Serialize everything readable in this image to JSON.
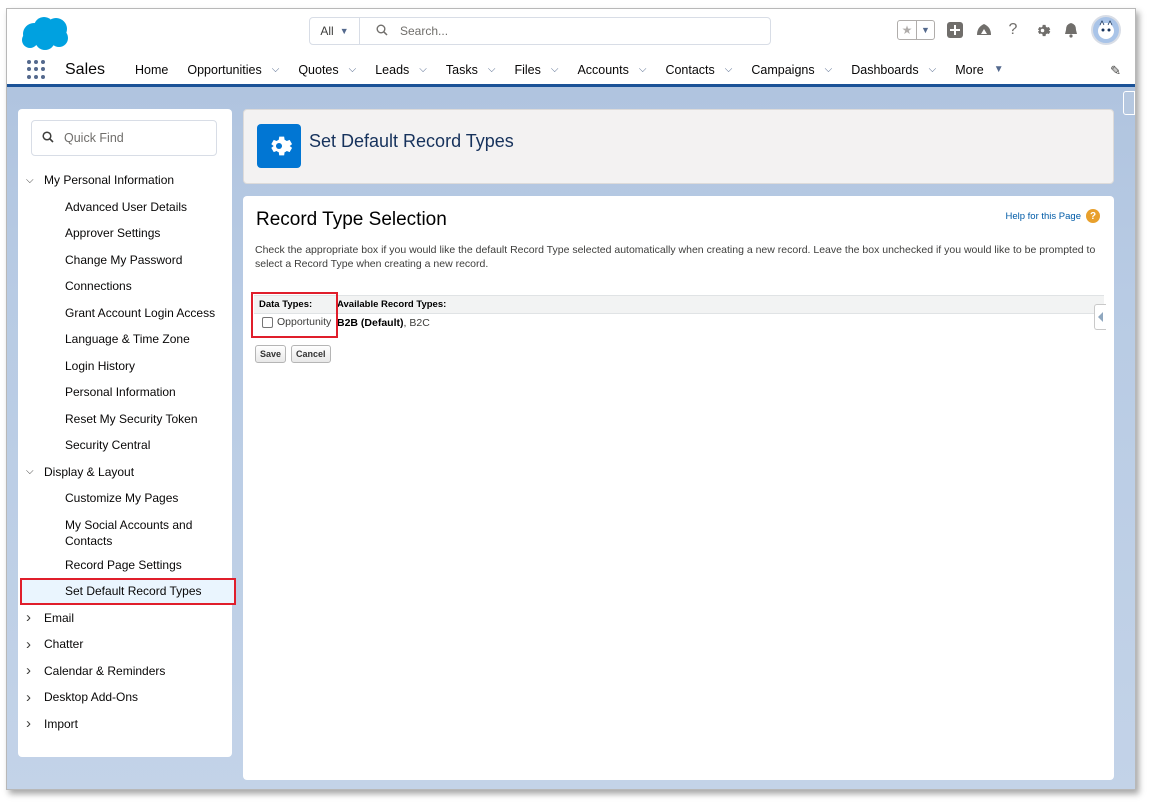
{
  "colors": {
    "brand": "#00a1e0",
    "accent": "#0176d3",
    "highlight": "#e01e2b"
  },
  "search": {
    "scope": "All",
    "placeholder": "Search..."
  },
  "nav": {
    "app_name": "Sales",
    "items": [
      {
        "label": "Home",
        "has_menu": false
      },
      {
        "label": "Opportunities",
        "has_menu": true
      },
      {
        "label": "Quotes",
        "has_menu": true
      },
      {
        "label": "Leads",
        "has_menu": true
      },
      {
        "label": "Tasks",
        "has_menu": true
      },
      {
        "label": "Files",
        "has_menu": true
      },
      {
        "label": "Accounts",
        "has_menu": true
      },
      {
        "label": "Contacts",
        "has_menu": true
      },
      {
        "label": "Campaigns",
        "has_menu": true
      },
      {
        "label": "Dashboards",
        "has_menu": true
      },
      {
        "label": "More",
        "has_menu": true
      }
    ]
  },
  "sidebar": {
    "quick_find": "Quick Find",
    "sections": [
      {
        "label": "My Personal Information",
        "expanded": true,
        "items": [
          "Advanced User Details",
          "Approver Settings",
          "Change My Password",
          "Connections",
          "Grant Account Login Access",
          "Language & Time Zone",
          "Login History",
          "Personal Information",
          "Reset My Security Token",
          "Security Central"
        ]
      },
      {
        "label": "Display & Layout",
        "expanded": true,
        "items": [
          "Customize My Pages",
          "My Social Accounts and Contacts",
          "Record Page Settings",
          "Set Default Record Types"
        ]
      },
      {
        "label": "Email",
        "expanded": false,
        "items": []
      },
      {
        "label": "Chatter",
        "expanded": false,
        "items": []
      },
      {
        "label": "Calendar & Reminders",
        "expanded": false,
        "items": []
      },
      {
        "label": "Desktop Add-Ons",
        "expanded": false,
        "items": []
      },
      {
        "label": "Import",
        "expanded": false,
        "items": []
      }
    ],
    "selected": "Set Default Record Types"
  },
  "header": {
    "title": "Set Default Record Types"
  },
  "main": {
    "title": "Record Type Selection",
    "help_link": "Help for this Page",
    "description": "Check the appropriate box if you would like the default Record Type selected automatically when creating a new record. Leave the box unchecked if you would like to be prompted to select a Record Type when creating a new record.",
    "table": {
      "col1_header": "Data Types:",
      "col2_header": "Available Record Types:",
      "row": {
        "checkbox_label": "Opportunity",
        "checked": false,
        "default_type": "B2B (Default)",
        "other_types": ", B2C"
      }
    },
    "save_label": "Save",
    "cancel_label": "Cancel"
  }
}
